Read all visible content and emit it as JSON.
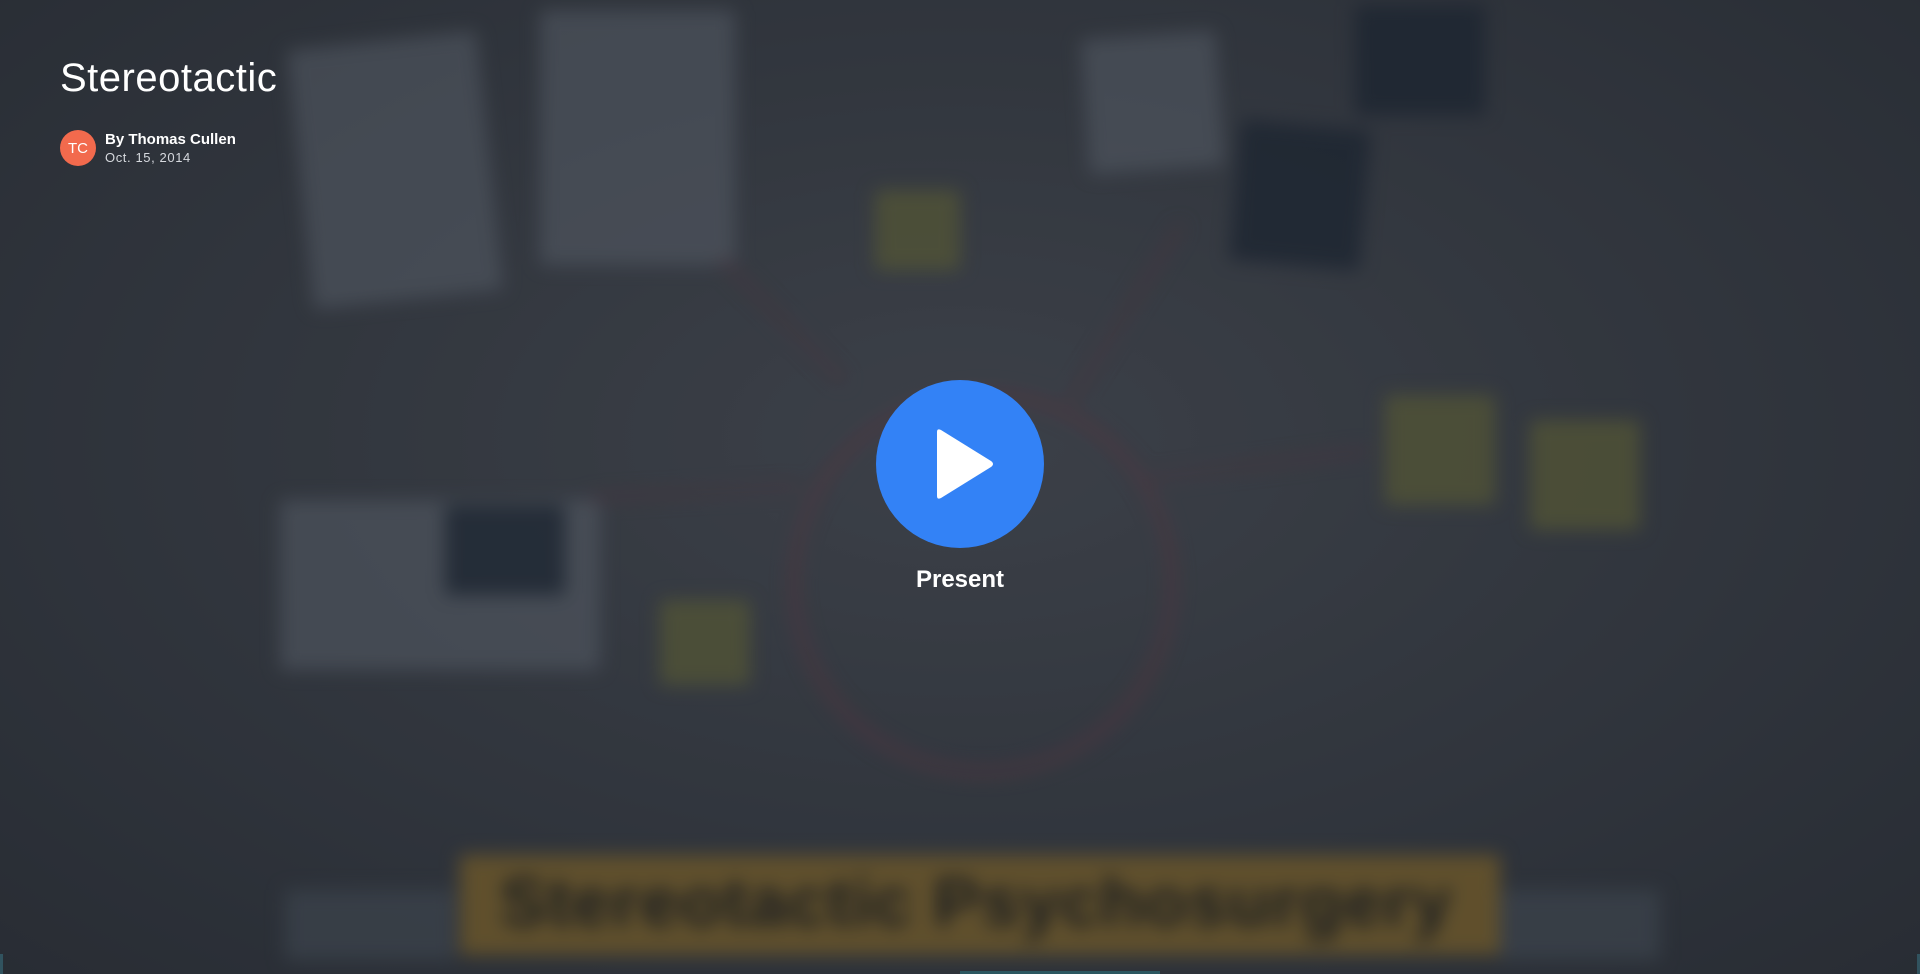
{
  "presentation": {
    "title": "Stereotactic",
    "banner_text": "Stereotactic Psychosurgery"
  },
  "author": {
    "initials": "TC",
    "byline": "By Thomas Cullen",
    "date": "Oct. 15, 2014",
    "avatar_color": "#f26a4d"
  },
  "present_button": {
    "label": "Present",
    "color": "#3382f6",
    "icon": "play-icon"
  }
}
